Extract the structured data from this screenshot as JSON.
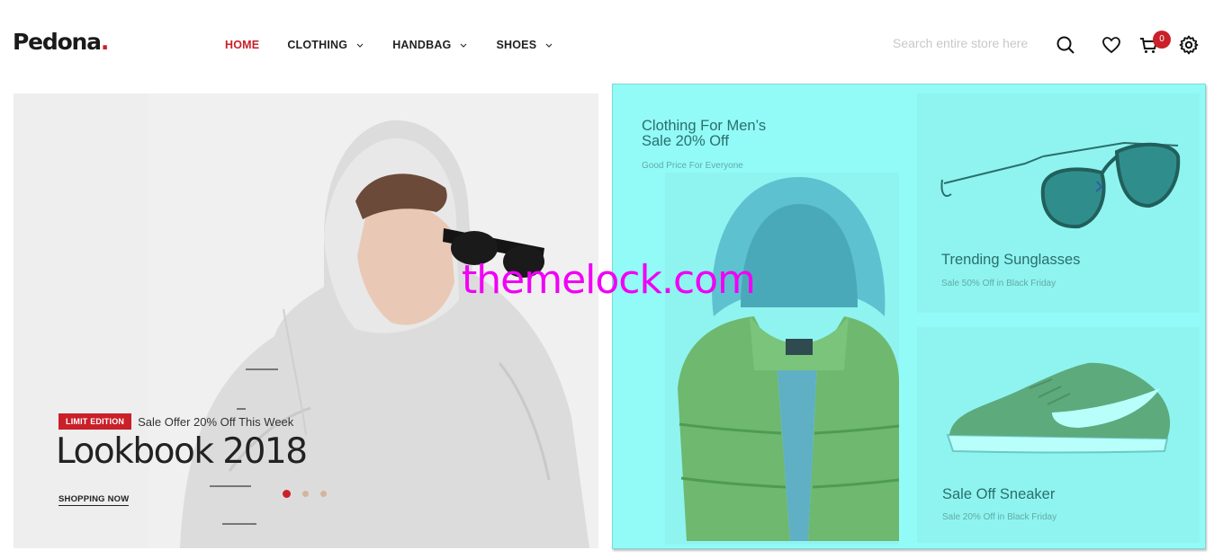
{
  "header": {
    "logo_text": "Pedona",
    "logo_dot": ".",
    "nav": [
      {
        "label": "HOME"
      },
      {
        "label": "CLOTHING"
      },
      {
        "label": "HANDBAG"
      },
      {
        "label": "SHOES"
      }
    ],
    "search_placeholder": "Search entire store here",
    "cart_count": "0",
    "icons": [
      "search-icon",
      "heart-icon",
      "cart-icon",
      "gear-icon"
    ]
  },
  "hero": {
    "badge": "LIMIT EDITION",
    "offer": "Sale Offer 20% Off This Week",
    "title": "Lookbook 2018",
    "cta": "SHOPPING NOW",
    "slides": 3,
    "active_slide": 1
  },
  "promos": [
    {
      "title_line1": "Clothing For Men’s",
      "title_line2": "Sale 20% Off",
      "subtitle": "Good Price For Everyone"
    },
    {
      "title_line1": "Trending Sunglasses",
      "subtitle": "Sale 50% Off in Black Friday"
    },
    {
      "title_line1": "Sale Off Sneaker",
      "subtitle": "Sale 20% Off in Black Friday"
    }
  ],
  "watermark": "themelock.com",
  "colors": {
    "accent": "#c9202a",
    "overlay": "#92fbf7",
    "promo_text": "#2a6f6c"
  }
}
